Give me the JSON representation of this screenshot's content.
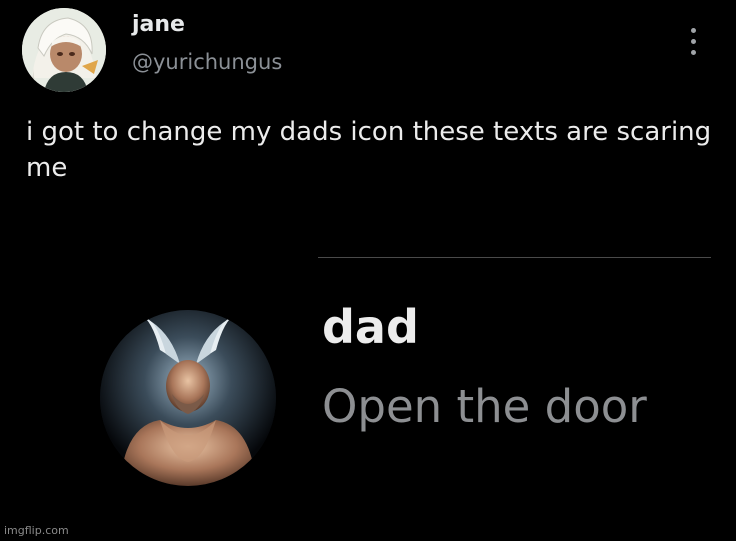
{
  "tweet": {
    "author": {
      "display_name": "jane",
      "handle": "@yurichungus",
      "avatar_icon": "anime-character-avatar-icon"
    },
    "text": "i got to change my dads icon these texts are scaring me",
    "more_icon": "more-options-icon"
  },
  "attachment": {
    "contact_name": "dad",
    "message_preview": "Open the door",
    "contact_avatar_icon": "bald-fighter-avatar-icon"
  },
  "watermark": "imgflip.com",
  "colors": {
    "background": "#000000",
    "primary_text": "#e7e9ea",
    "secondary_text": "#8b9096",
    "preview_text": "#8d8f92"
  }
}
